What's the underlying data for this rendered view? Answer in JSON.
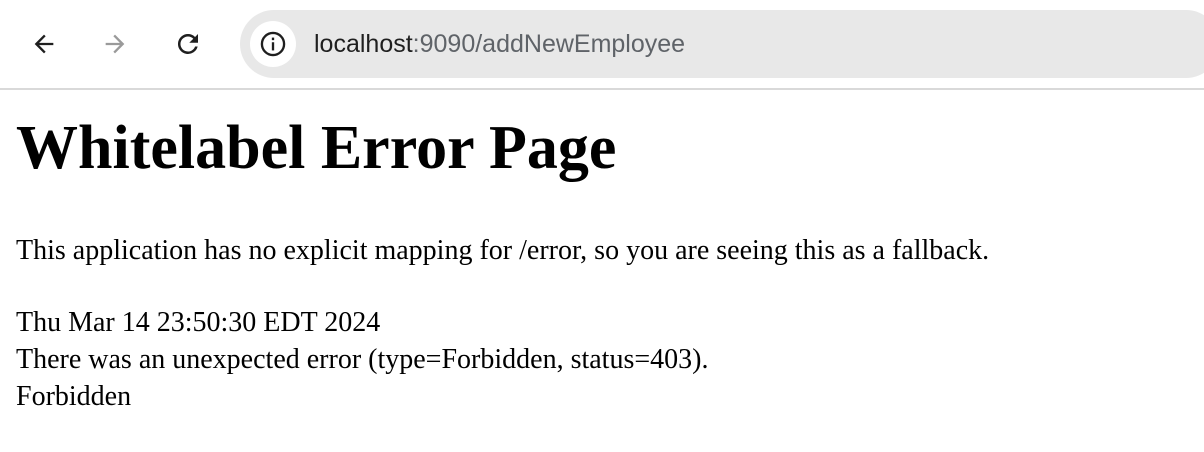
{
  "browser": {
    "url_host": "localhost",
    "url_path": ":9090/addNewEmployee",
    "icons": {
      "back": "arrow-left-icon",
      "forward": "arrow-right-icon",
      "reload": "reload-icon",
      "site_info": "info-icon"
    }
  },
  "page": {
    "title": "Whitelabel Error Page",
    "message": "This application has no explicit mapping for /error, so you are seeing this as a fallback.",
    "timestamp": "Thu Mar 14 23:50:30 EDT 2024",
    "error_line": "There was an unexpected error (type=Forbidden, status=403).",
    "error_detail": "Forbidden"
  }
}
